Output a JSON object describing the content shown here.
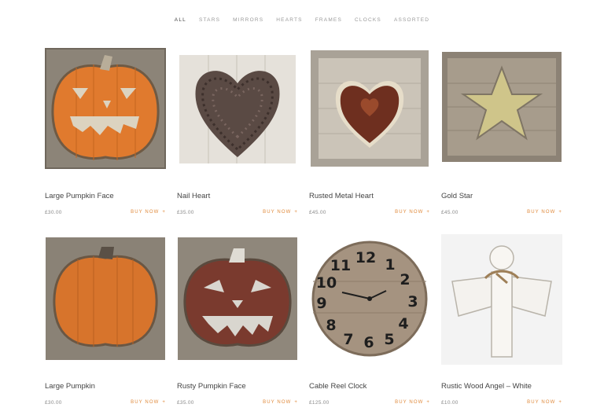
{
  "filters": [
    {
      "label": "ALL",
      "active": true
    },
    {
      "label": "STARS"
    },
    {
      "label": "MIRRORS"
    },
    {
      "label": "HEARTS"
    },
    {
      "label": "FRAMES"
    },
    {
      "label": "CLOCKS"
    },
    {
      "label": "ASSORTED"
    }
  ],
  "buy_label": "BUY NOW",
  "buy_arrow": "+",
  "products": [
    {
      "name": "Large Pumpkin Face",
      "price": "£30.00"
    },
    {
      "name": "Nail Heart",
      "price": "£35.00"
    },
    {
      "name": "Rusted Metal Heart",
      "price": "£45.00"
    },
    {
      "name": "Gold Star",
      "price": "£45.00"
    },
    {
      "name": "Large Pumpkin",
      "price": "£30.00"
    },
    {
      "name": "Rusty Pumpkin Face",
      "price": "£35.00"
    },
    {
      "name": "Cable Reel Clock",
      "price": "£125.00"
    },
    {
      "name": "Rustic Wood Angel – White",
      "price": "£10.00"
    }
  ],
  "clock_numbers": [
    "12",
    "1",
    "2",
    "3",
    "4",
    "5",
    "6",
    "7",
    "8",
    "9",
    "10",
    "11"
  ],
  "colors": {
    "accent": "#e08a3c",
    "text": "#444444",
    "muted": "#8a8a8a"
  }
}
